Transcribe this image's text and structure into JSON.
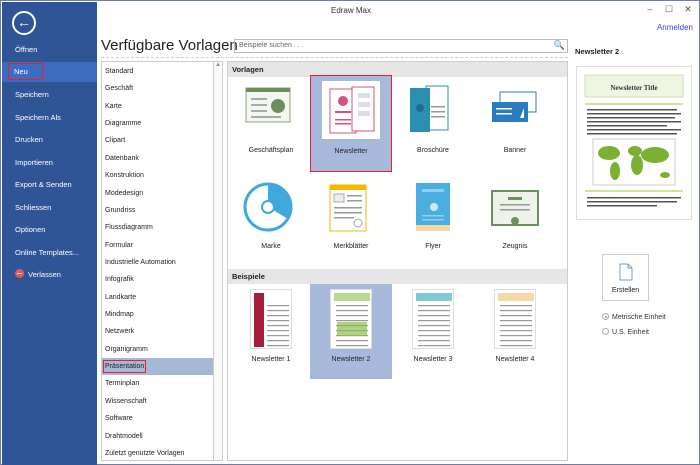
{
  "window": {
    "title": "Edraw Max",
    "minimize": "–",
    "maximize": "☐",
    "close": "✕",
    "login": "Anmelden"
  },
  "sidebar": {
    "back": "←",
    "items": [
      {
        "label": "Öffnen"
      },
      {
        "label": "Neu",
        "selected": true
      },
      {
        "label": "Speichern"
      },
      {
        "label": "Speichern Als"
      },
      {
        "label": "Drucken"
      },
      {
        "label": "Importieren"
      },
      {
        "label": "Export & Senden"
      },
      {
        "label": "Schliessen"
      },
      {
        "label": "Optionen"
      },
      {
        "label": "Online Templates..."
      },
      {
        "label": "Verlassen"
      }
    ]
  },
  "heading": "Verfügbare Vorlagen",
  "search": {
    "placeholder": "Beispiele suchen . . ."
  },
  "categories": [
    "Standard",
    "Geschäft",
    "Karte",
    "Diagramme",
    "Clipart",
    "Datenbank",
    "Konstruktion",
    "Modedesign",
    "Grundriss",
    "Flussdiagramm",
    "Formular",
    "Industrielle Automation",
    "Infografik",
    "Landkarte",
    "Mindmap",
    "Netzwerk",
    "Organigramm",
    "Präsentation",
    "Terminplan",
    "Wissenschaft",
    "Software",
    "Drahtmodell",
    "Zuletzt genutzte Vorlagen"
  ],
  "selected_category": "Präsentation",
  "sections": {
    "templates": "Vorlagen",
    "examples": "Beispiele"
  },
  "templates": [
    "Geschäftsplan",
    "Newsletter",
    "Broschüre",
    "Banner",
    "Marke",
    "Merkblätter",
    "Flyer",
    "Zeugnis"
  ],
  "examples": [
    "Newsletter 1",
    "Newsletter 2",
    "Newsletter 3",
    "Newsletter 4"
  ],
  "right": {
    "title": "Newsletter 2",
    "preview_title": "Newsletter Title",
    "create": "Erstellen",
    "units": [
      "Metrische Einheit",
      "U.S. Einheit"
    ]
  },
  "colors": {
    "sidebar": "#2f5597",
    "selection": "#a8badc",
    "highlight": "#e8202a"
  }
}
